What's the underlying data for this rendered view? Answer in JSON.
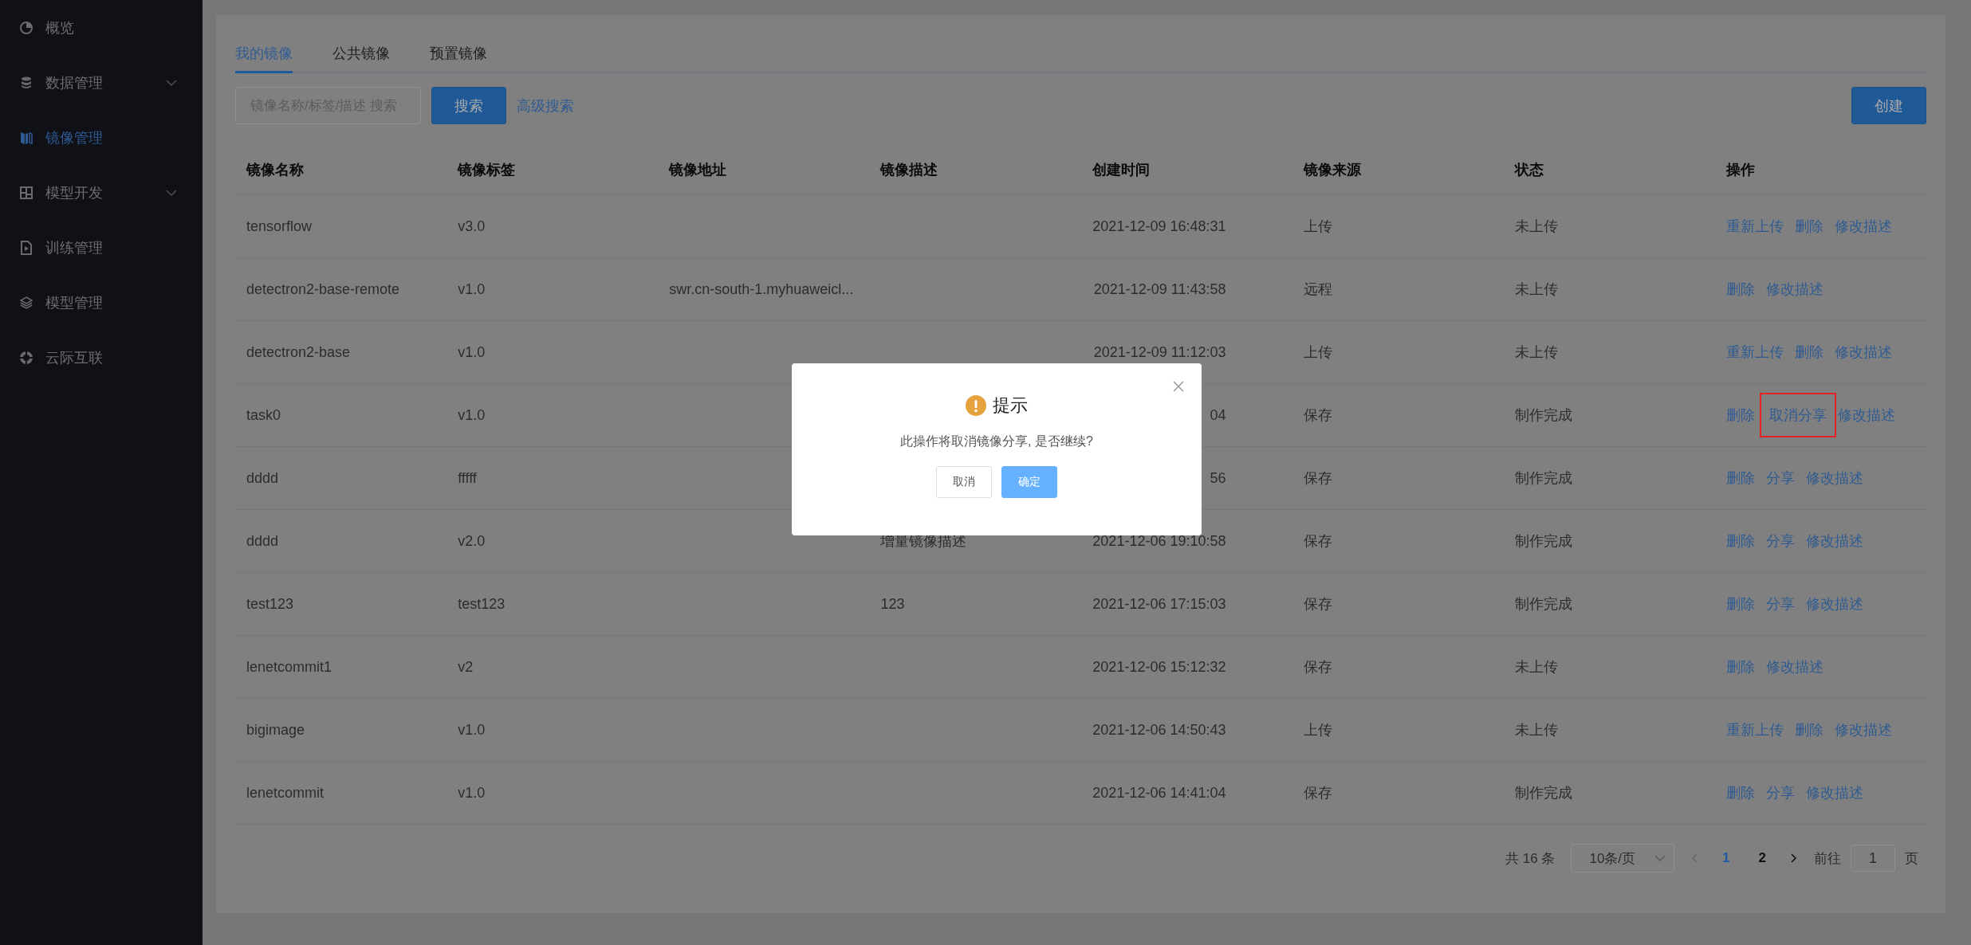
{
  "sidebar": {
    "items": [
      {
        "label": "概览",
        "selected": false,
        "expandable": false
      },
      {
        "label": "数据管理",
        "selected": false,
        "expandable": true
      },
      {
        "label": "镜像管理",
        "selected": true,
        "expandable": false
      },
      {
        "label": "模型开发",
        "selected": false,
        "expandable": true
      },
      {
        "label": "训练管理",
        "selected": false,
        "expandable": false
      },
      {
        "label": "模型管理",
        "selected": false,
        "expandable": false
      },
      {
        "label": "云际互联",
        "selected": false,
        "expandable": false
      }
    ]
  },
  "tabs": [
    {
      "label": "我的镜像",
      "selected": true
    },
    {
      "label": "公共镜像",
      "selected": false
    },
    {
      "label": "预置镜像",
      "selected": false
    }
  ],
  "search": {
    "placeholder": "镜像名称/标签/描述 搜索",
    "button": "搜索",
    "advanced": "高级搜索"
  },
  "create_button": "创建",
  "table": {
    "columns": [
      "镜像名称",
      "镜像标签",
      "镜像地址",
      "镜像描述",
      "创建时间",
      "镜像来源",
      "状态",
      "操作"
    ],
    "rows": [
      {
        "name": "tensorflow",
        "tag": "v3.0",
        "address": "",
        "description": "",
        "created": "2021-12-09 16:48:31",
        "source": "上传",
        "status": "未上传",
        "actions": [
          {
            "label": "重新上传",
            "highlighted": false
          },
          {
            "label": "删除",
            "highlighted": false
          },
          {
            "label": "修改描述",
            "highlighted": false
          }
        ]
      },
      {
        "name": "detectron2-base-remote",
        "tag": "v1.0",
        "address": "swr.cn-south-1.myhuaweicl...",
        "description": "",
        "created": "2021-12-09 11:43:58",
        "source": "远程",
        "status": "未上传",
        "actions": [
          {
            "label": "删除",
            "highlighted": false
          },
          {
            "label": "修改描述",
            "highlighted": false
          }
        ]
      },
      {
        "name": "detectron2-base",
        "tag": "v1.0",
        "address": "",
        "description": "",
        "created": "2021-12-09 11:12:03",
        "source": "上传",
        "status": "未上传",
        "actions": [
          {
            "label": "重新上传",
            "highlighted": false
          },
          {
            "label": "删除",
            "highlighted": false
          },
          {
            "label": "修改描述",
            "highlighted": false
          }
        ]
      },
      {
        "name": "task0",
        "tag": "v1.0",
        "address": "",
        "description": "",
        "created": "04",
        "source": "保存",
        "status": "制作完成",
        "actions": [
          {
            "label": "删除",
            "highlighted": false
          },
          {
            "label": "取消分享",
            "highlighted": true
          },
          {
            "label": "修改描述",
            "highlighted": false
          }
        ]
      },
      {
        "name": "dddd",
        "tag": "fffff",
        "address": "",
        "description": "",
        "created": "56",
        "source": "保存",
        "status": "制作完成",
        "actions": [
          {
            "label": "删除",
            "highlighted": false
          },
          {
            "label": "分享",
            "highlighted": false
          },
          {
            "label": "修改描述",
            "highlighted": false
          }
        ]
      },
      {
        "name": "dddd",
        "tag": "v2.0",
        "address": "",
        "description": "增量镜像描述",
        "created": "2021-12-06 19:10:58",
        "source": "保存",
        "status": "制作完成",
        "actions": [
          {
            "label": "删除",
            "highlighted": false
          },
          {
            "label": "分享",
            "highlighted": false
          },
          {
            "label": "修改描述",
            "highlighted": false
          }
        ]
      },
      {
        "name": "test123",
        "tag": "test123",
        "address": "",
        "description": "123",
        "created": "2021-12-06 17:15:03",
        "source": "保存",
        "status": "制作完成",
        "actions": [
          {
            "label": "删除",
            "highlighted": false
          },
          {
            "label": "分享",
            "highlighted": false
          },
          {
            "label": "修改描述",
            "highlighted": false
          }
        ]
      },
      {
        "name": "lenetcommit1",
        "tag": "v2",
        "address": "",
        "description": "",
        "created": "2021-12-06 15:12:32",
        "source": "保存",
        "status": "未上传",
        "actions": [
          {
            "label": "删除",
            "highlighted": false
          },
          {
            "label": "修改描述",
            "highlighted": false
          }
        ]
      },
      {
        "name": "bigimage",
        "tag": "v1.0",
        "address": "",
        "description": "",
        "created": "2021-12-06 14:50:43",
        "source": "上传",
        "status": "未上传",
        "actions": [
          {
            "label": "重新上传",
            "highlighted": false
          },
          {
            "label": "删除",
            "highlighted": false
          },
          {
            "label": "修改描述",
            "highlighted": false
          }
        ]
      },
      {
        "name": "lenetcommit",
        "tag": "v1.0",
        "address": "",
        "description": "",
        "created": "2021-12-06 14:41:04",
        "source": "保存",
        "status": "制作完成",
        "actions": [
          {
            "label": "删除",
            "highlighted": false
          },
          {
            "label": "分享",
            "highlighted": false
          },
          {
            "label": "修改描述",
            "highlighted": false
          }
        ]
      }
    ]
  },
  "pagination": {
    "total": "共 16 条",
    "page_size": "10条/页",
    "pages": [
      {
        "label": "1",
        "selected": true
      },
      {
        "label": "2",
        "selected": false
      }
    ],
    "goto_label": "前往",
    "goto_value": "1",
    "goto_suffix": "页"
  },
  "dialog": {
    "title": "提示",
    "message": "此操作将取消镜像分享, 是否继续?",
    "cancel": "取消",
    "confirm": "确定"
  }
}
